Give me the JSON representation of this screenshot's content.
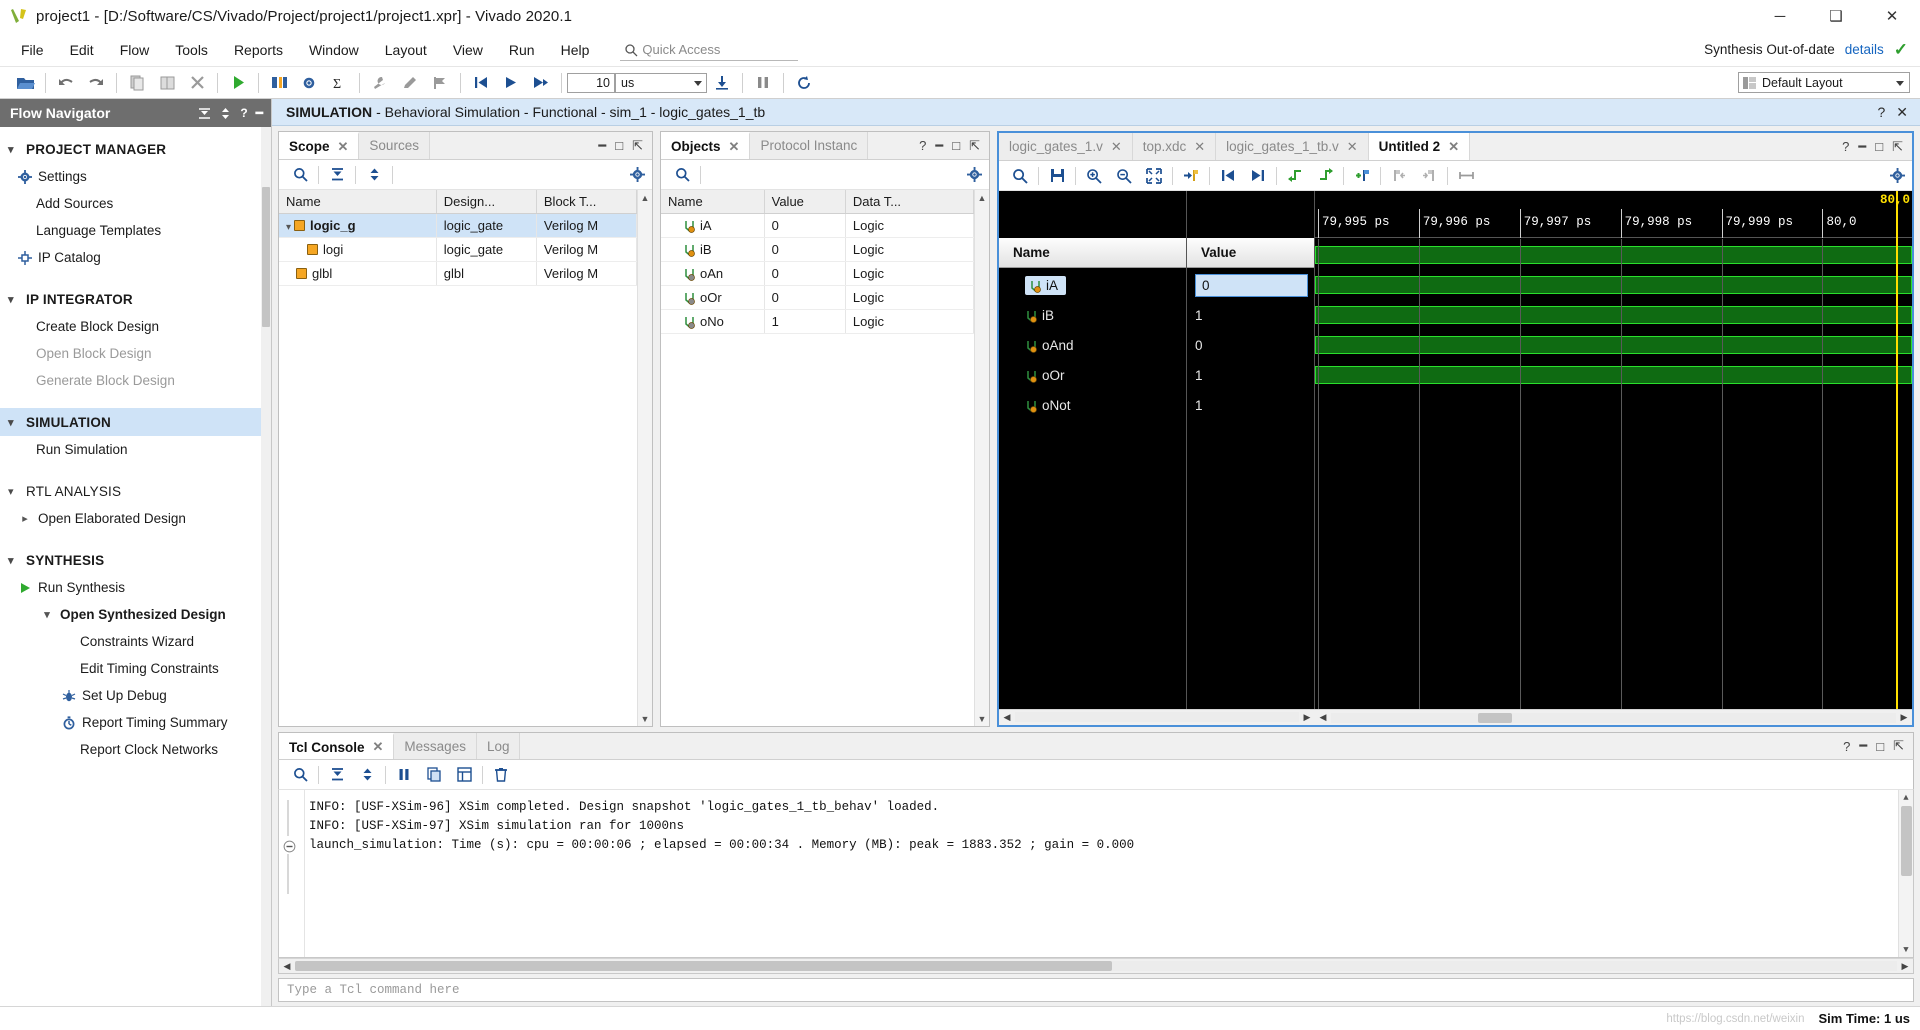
{
  "window": {
    "title": "project1 - [D:/Software/CS/Vivado/Project/project1/project1.xpr] - Vivado 2020.1",
    "minimize": "─",
    "maximize": "❑",
    "close": "✕"
  },
  "menubar": {
    "items": [
      "File",
      "Edit",
      "Flow",
      "Tools",
      "Reports",
      "Window",
      "Layout",
      "View",
      "Run",
      "Help"
    ],
    "quick_access_placeholder": "Quick Access",
    "status_label": "Synthesis Out-of-date",
    "status_details": "details"
  },
  "toolbar": {
    "run_time_value": "10",
    "run_time_unit": "us",
    "layout_value": "Default Layout"
  },
  "flow_navigator": {
    "title": "Flow Navigator",
    "sections": [
      {
        "label": "PROJECT MANAGER",
        "expanded": true,
        "highlight": false,
        "items": [
          {
            "label": "Settings",
            "icon": "gear-icon",
            "dim": false
          },
          {
            "label": "Add Sources",
            "icon": "",
            "dim": false
          },
          {
            "label": "Language Templates",
            "icon": "",
            "dim": false
          },
          {
            "label": "IP Catalog",
            "icon": "ip-icon",
            "dim": false
          }
        ]
      },
      {
        "label": "IP INTEGRATOR",
        "expanded": true,
        "highlight": false,
        "items": [
          {
            "label": "Create Block Design",
            "icon": "",
            "dim": false
          },
          {
            "label": "Open Block Design",
            "icon": "",
            "dim": true
          },
          {
            "label": "Generate Block Design",
            "icon": "",
            "dim": true
          }
        ]
      },
      {
        "label": "SIMULATION",
        "expanded": true,
        "highlight": true,
        "items": [
          {
            "label": "Run Simulation",
            "icon": "",
            "dim": false
          }
        ]
      },
      {
        "label": "RTL ANALYSIS",
        "expanded": true,
        "highlight": false,
        "bold": false,
        "items": [
          {
            "label": "Open Elaborated Design",
            "icon": "chevron-right-icon",
            "dim": false
          }
        ]
      },
      {
        "label": "SYNTHESIS",
        "expanded": true,
        "highlight": false,
        "items": [
          {
            "label": "Run Synthesis",
            "icon": "play-icon",
            "dim": false
          },
          {
            "label": "Open Synthesized Design",
            "icon": "chevron-down-icon",
            "dim": false,
            "bold": true
          },
          {
            "label": "Constraints Wizard",
            "icon": "",
            "dim": false,
            "indent": 2
          },
          {
            "label": "Edit Timing Constraints",
            "icon": "",
            "dim": false,
            "indent": 2
          },
          {
            "label": "Set Up Debug",
            "icon": "bug-icon",
            "dim": false,
            "indent": 2
          },
          {
            "label": "Report Timing Summary",
            "icon": "clock-icon",
            "dim": false,
            "indent": 2
          },
          {
            "label": "Report Clock Networks",
            "icon": "",
            "dim": false,
            "indent": 2
          }
        ]
      }
    ]
  },
  "sim_banner": {
    "prefix": "SIMULATION",
    "rest": "- Behavioral Simulation - Functional - sim_1 - logic_gates_1_tb"
  },
  "scope_panel": {
    "tabs": [
      {
        "label": "Scope",
        "active": true,
        "closable": true
      },
      {
        "label": "Sources",
        "active": false,
        "closable": false
      }
    ],
    "columns": [
      "Name",
      "Design...",
      "Block T..."
    ],
    "rows": [
      {
        "name": "logic_g",
        "design": "logic_gate",
        "block": "Verilog M",
        "indent": 0,
        "selected": true,
        "expanded": true,
        "icon": "module-icon"
      },
      {
        "name": "logi",
        "design": "logic_gate",
        "block": "Verilog M",
        "indent": 1,
        "selected": false,
        "expanded": false,
        "icon": "module-icon"
      },
      {
        "name": "glbl",
        "design": "glbl",
        "block": "Verilog M",
        "indent": 0,
        "selected": false,
        "expanded": false,
        "icon": "module-icon"
      }
    ]
  },
  "objects_panel": {
    "tabs": [
      {
        "label": "Objects",
        "active": true,
        "closable": true
      },
      {
        "label": "Protocol Instanc",
        "active": false,
        "closable": false
      }
    ],
    "columns": [
      "Name",
      "Value",
      "Data T..."
    ],
    "rows": [
      {
        "name": "iA",
        "value": "0",
        "type": "Logic",
        "icon": "input-signal-icon"
      },
      {
        "name": "iB",
        "value": "0",
        "type": "Logic",
        "icon": "input-signal-icon"
      },
      {
        "name": "oAn",
        "value": "0",
        "type": "Logic",
        "icon": "output-signal-icon"
      },
      {
        "name": "oOr",
        "value": "0",
        "type": "Logic",
        "icon": "output-signal-icon"
      },
      {
        "name": "oNo",
        "value": "1",
        "type": "Logic",
        "icon": "output-signal-icon"
      }
    ]
  },
  "wave_panel": {
    "tabs": [
      {
        "label": "logic_gates_1.v",
        "active": false,
        "closable": true
      },
      {
        "label": "top.xdc",
        "active": false,
        "closable": true
      },
      {
        "label": "logic_gates_1_tb.v",
        "active": false,
        "closable": true
      },
      {
        "label": "Untitled 2",
        "active": true,
        "closable": true
      }
    ],
    "columns": {
      "name": "Name",
      "value": "Value"
    },
    "signals": [
      {
        "name": "iA",
        "value": "0",
        "selected": true,
        "level": "high"
      },
      {
        "name": "iB",
        "value": "1",
        "selected": false,
        "level": "high"
      },
      {
        "name": "oAnd",
        "value": "0",
        "selected": false,
        "level": "high"
      },
      {
        "name": "oOr",
        "value": "1",
        "selected": false,
        "level": "high"
      },
      {
        "name": "oNot",
        "value": "1",
        "selected": false,
        "level": "high"
      }
    ],
    "ruler_ticks": [
      "79,995 ps",
      "79,996 ps",
      "79,997 ps",
      "79,998 ps",
      "79,999 ps",
      "80,0"
    ],
    "cursor_label": "80,0"
  },
  "console": {
    "tabs": [
      {
        "label": "Tcl Console",
        "active": true,
        "closable": true
      },
      {
        "label": "Messages",
        "active": false,
        "closable": false
      },
      {
        "label": "Log",
        "active": false,
        "closable": false
      }
    ],
    "lines": [
      "INFO: [USF-XSim-96] XSim completed. Design snapshot 'logic_gates_1_tb_behav' loaded.",
      "INFO: [USF-XSim-97] XSim simulation ran for 1000ns",
      "launch_simulation: Time (s): cpu = 00:00:06 ; elapsed = 00:00:34 . Memory (MB): peak = 1883.352 ; gain = 0.000"
    ],
    "input_placeholder": "Type a Tcl command here"
  },
  "statusbar": {
    "watermark": "https://blog.csdn.net/weixin",
    "sim_time": "Sim Time: 1 us"
  },
  "colors": {
    "accent": "#4a90d9",
    "banner": "#d8e8f8",
    "wave_green": "#29e02c",
    "wave_green_fill": "#0f6b12",
    "cursor_yellow": "#ffe000",
    "module_orange": "#f5a623",
    "ok_green": "#2e9e2e",
    "link_blue": "#1565c0"
  }
}
